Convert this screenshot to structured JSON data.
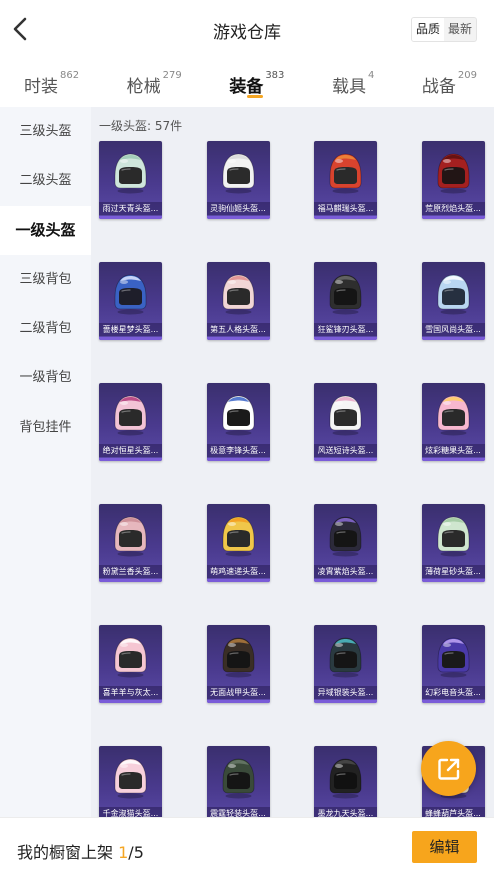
{
  "header": {
    "title": "游戏仓库",
    "sort_options": [
      "品质",
      "最新"
    ],
    "sort_active": 0
  },
  "tabs": [
    {
      "label": "时装",
      "count": "862"
    },
    {
      "label": "枪械",
      "count": "279"
    },
    {
      "label": "装备",
      "count": "383"
    },
    {
      "label": "载具",
      "count": "4"
    },
    {
      "label": "战备",
      "count": "209"
    }
  ],
  "active_tab": 2,
  "sidebar": {
    "items": [
      "三级头盔",
      "二级头盔",
      "一级头盔",
      "三级背包",
      "二级背包",
      "一级背包",
      "背包挂件"
    ],
    "active": 2
  },
  "section": {
    "label": "一级头盔: 57件"
  },
  "items": [
    {
      "name": "雨过天青头盔...",
      "shell": "#cfe6dc",
      "accent": "#9cc9b4",
      "visor": "#2a2a2a"
    },
    {
      "name": "灵驹仙姬头盔...",
      "shell": "#f2f2f2",
      "accent": "#d9d9d9",
      "visor": "#2b2b2b"
    },
    {
      "name": "福马麒瑞头盔...",
      "shell": "#d8432e",
      "accent": "#f08a3a",
      "visor": "#2a2a2a"
    },
    {
      "name": "荒原烈焰头盔...",
      "shell": "#a42020",
      "accent": "#5c1010",
      "visor": "#221515"
    },
    {
      "name": "蔷楼星梦头盔...",
      "shell": "#3a62c4",
      "accent": "#dfe6ff",
      "visor": "#1e1e2a"
    },
    {
      "name": "第五人格头盔...",
      "shell": "#f1d6d6",
      "accent": "#e08c8c",
      "visor": "#2a2a2a"
    },
    {
      "name": "狂鲨锋刃头盔...",
      "shell": "#2e2e2e",
      "accent": "#6a6a6a",
      "visor": "#151515"
    },
    {
      "name": "雪国风尚头盔...",
      "shell": "#b9d6f2",
      "accent": "#ffffff",
      "visor": "#263040"
    },
    {
      "name": "绝对恒星头盔...",
      "shell": "#f2c3d6",
      "accent": "#b23a7a",
      "visor": "#2a2a2a"
    },
    {
      "name": "极意李锋头盔...",
      "shell": "#ffffff",
      "accent": "#3a64c8",
      "visor": "#1a1a1a"
    },
    {
      "name": "风送短诗头盔...",
      "shell": "#f5f5f5",
      "accent": "#e6a6c6",
      "visor": "#2b2b2b"
    },
    {
      "name": "炫彩糖果头盔...",
      "shell": "#f7b7cf",
      "accent": "#ffd060",
      "visor": "#2a2a2a"
    },
    {
      "name": "粉黛兰香头盔...",
      "shell": "#e6b7bd",
      "accent": "#c98b93",
      "visor": "#2a2a2a"
    },
    {
      "name": "萌鸡速递头盔...",
      "shell": "#f0c64a",
      "accent": "#f59b1f",
      "visor": "#2a2a2a"
    },
    {
      "name": "凌霄紫焰头盔...",
      "shell": "#2c2a3a",
      "accent": "#8a6bd6",
      "visor": "#151515"
    },
    {
      "name": "薄荷星砂头盔...",
      "shell": "#cfe6cf",
      "accent": "#9fc79f",
      "visor": "#2a2a2a"
    },
    {
      "name": "喜羊羊与灰太...",
      "shell": "#f5c6d2",
      "accent": "#ffffff",
      "visor": "#2a2a2a"
    },
    {
      "name": "无面战甲头盔...",
      "shell": "#3a2e26",
      "accent": "#b07a3e",
      "visor": "#151515"
    },
    {
      "name": "异域银装头盔...",
      "shell": "#2a3a40",
      "accent": "#4ec0c8",
      "visor": "#151515"
    },
    {
      "name": "幻彩电音头盔...",
      "shell": "#4a3aa8",
      "accent": "#c0a6f5",
      "visor": "#1a1a1a"
    },
    {
      "name": "千金淑猫头盔...",
      "shell": "#f7d0dc",
      "accent": "#ffffff",
      "visor": "#2a2a2a"
    },
    {
      "name": "震霆轻装头盔...",
      "shell": "#3a4a3a",
      "accent": "#6a7a6a",
      "visor": "#151515"
    },
    {
      "name": "墨龙九天头盔...",
      "shell": "#222222",
      "accent": "#4a4a4a",
      "visor": "#111111"
    },
    {
      "name": "蜂蜂葫芦头盔...",
      "shell": "#f0e0c0",
      "accent": "#d9b77a",
      "visor": "#2a2a2a"
    }
  ],
  "shelf": {
    "label": "我的橱窗上架",
    "count": "1",
    "total": "/5"
  },
  "edit_button": "编辑",
  "colors": {
    "accent": "#f7a51c",
    "card_bg": "#4a3a8e",
    "sidebar_bg": "#f4f6fa",
    "main_bg": "#eef0f5"
  }
}
